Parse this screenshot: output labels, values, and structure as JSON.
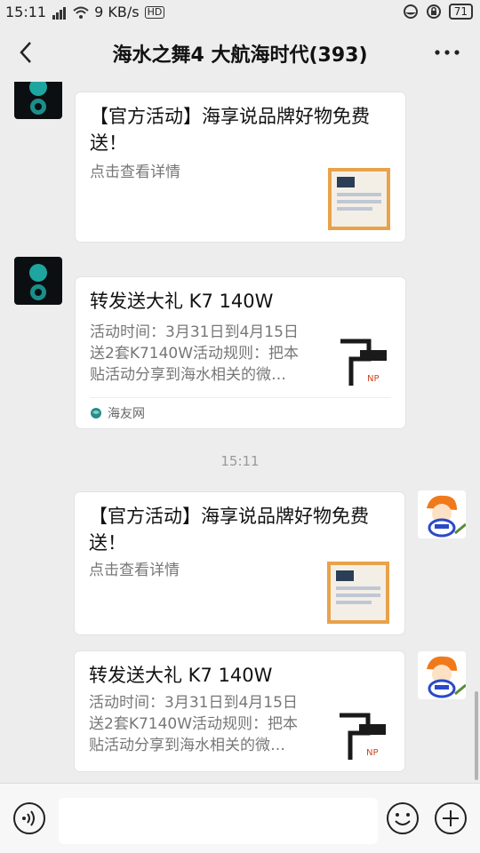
{
  "status": {
    "time": "15:11",
    "network_speed": "9 KB/s",
    "hd": "HD",
    "battery": "71"
  },
  "header": {
    "title": "海水之舞4 大航海时代(393)",
    "back_icon": "chevron-left-icon",
    "more_icon": "ellipsis-icon"
  },
  "messages": [
    {
      "sender": "other",
      "title": "【官方活动】海享说品牌好物免费送！",
      "desc": "点击查看详情"
    },
    {
      "sender": "other",
      "title": "转发送大礼 K7 140W",
      "desc": "活动时间：3月31日到4月15日送2套K7140W活动规则：把本贴活动分享到海水相关的微…",
      "source": "海友网"
    },
    {
      "timestamp": "15:11"
    },
    {
      "sender": "self",
      "title": "【官方活动】海享说品牌好物免费送！",
      "desc": "点击查看详情"
    },
    {
      "sender": "self",
      "title": "转发送大礼 K7 140W",
      "desc": "活动时间：3月31日到4月15日送2套K7140W活动规则：把本贴活动分享到海水相关的微…"
    }
  ],
  "input": {
    "placeholder": ""
  }
}
